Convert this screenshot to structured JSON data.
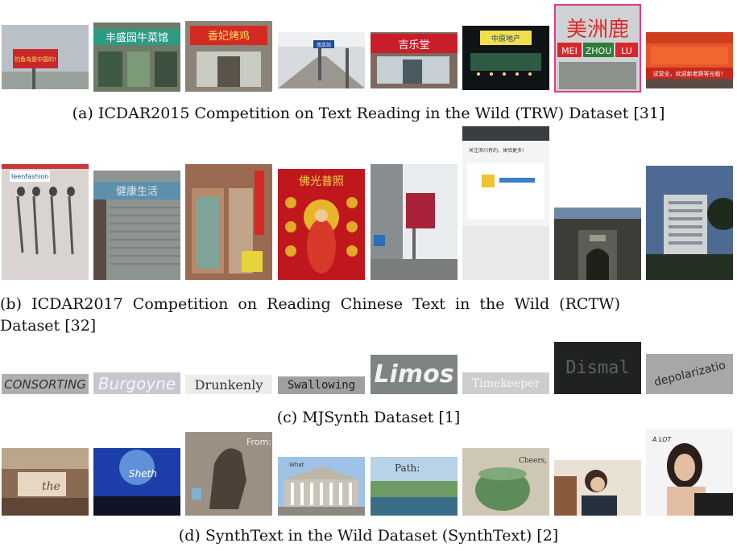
{
  "figure": {
    "row_a": {
      "caption": "(a) ICDAR2015 Competition on Text Reading in the Wild (TRW) Dataset [31]",
      "images": [
        {
          "sign_text": "钓鱼岛是中国的!"
        },
        {
          "sign_text": "丰盛园牛菜馆"
        },
        {
          "sign_text": "香妃烤鸡"
        },
        {
          "sign_text": "南京站"
        },
        {
          "sign_text": "吉乐堂"
        },
        {
          "sign_text": "中原地产"
        },
        {
          "sign_text": "美洲鹿",
          "sub_words": [
            "MEI",
            "ZHOU",
            "LU"
          ]
        },
        {
          "sign_text": "试营业，欢迎新老顾客光临！"
        }
      ]
    },
    "row_b": {
      "caption_line1": "(b)  ICDAR2017  Competition  on  Reading  Chinese  Text  in  the  Wild  (RCTW)",
      "caption_line2": "Dataset [32]",
      "images": [
        {
          "sign_text": "Ieenfashion"
        },
        {
          "sign_text": "健康生活"
        },
        {
          "sign_text": ""
        },
        {
          "sign_text": "佛光普照"
        },
        {
          "sign_text": ""
        },
        {
          "sign_text": "关注滨川有约，体验更多!"
        },
        {
          "sign_text": ""
        },
        {
          "sign_text": ""
        }
      ]
    },
    "row_c": {
      "caption": "(c) MJSynth Dataset [1]",
      "words": [
        "CONSORTING",
        "Burgoyne",
        "Drunkenly",
        "Swallowing",
        "Limos",
        "Timekeeper",
        "Dismal",
        "depolarizatio"
      ]
    },
    "row_d": {
      "caption": "(d) SynthText in the Wild Dataset (SynthText) [2]",
      "images": [
        {
          "overlay_text": "the"
        },
        {
          "overlay_text": "Sheth"
        },
        {
          "overlay_text": "From:"
        },
        {
          "overlay_text": "What"
        },
        {
          "overlay_text": "Path:"
        },
        {
          "overlay_text": "Cheers,"
        },
        {
          "overlay_text": ""
        },
        {
          "overlay_text": "A LOT"
        }
      ]
    }
  }
}
